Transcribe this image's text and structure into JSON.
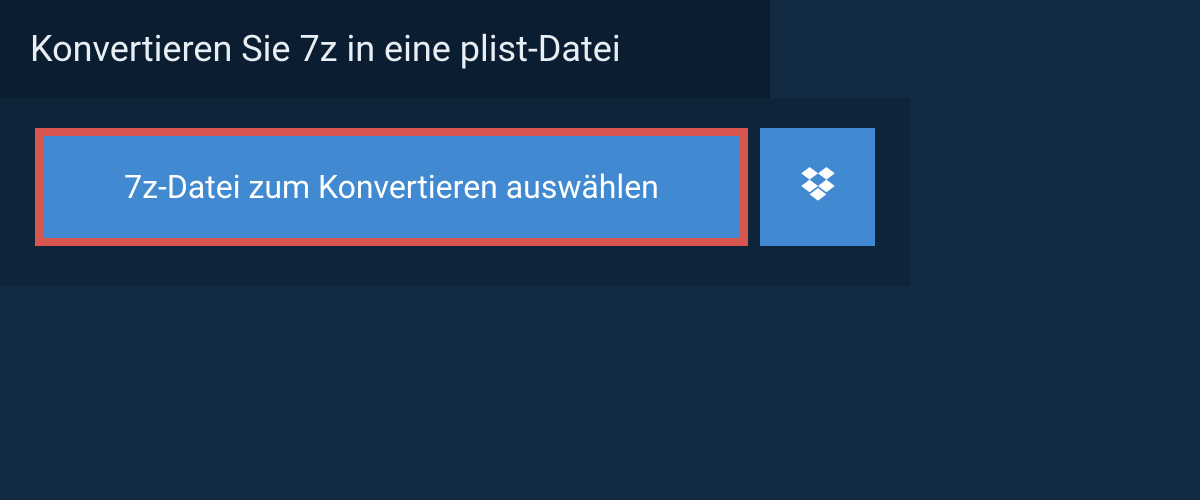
{
  "header": {
    "title": "Konvertieren Sie 7z in eine plist-Datei"
  },
  "actions": {
    "select_file_label": "7z-Datei zum Konvertieren auswählen",
    "dropbox_icon": "dropbox-icon"
  },
  "colors": {
    "page_bg": "#122b42",
    "header_bg": "#0b1e31",
    "panel_bg": "#0e2438",
    "button_bg": "#4189d0",
    "highlight_border": "#d9554f",
    "text_light": "#e8eef4",
    "text_white": "#ffffff"
  }
}
